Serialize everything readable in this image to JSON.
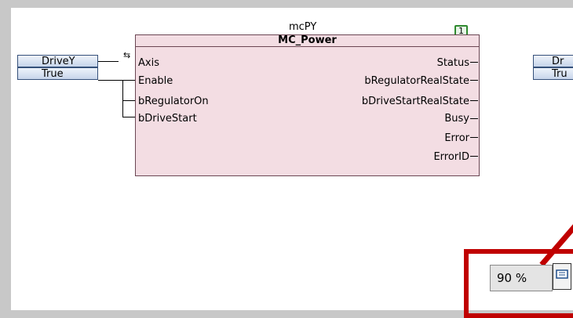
{
  "instance_name": "mcPY",
  "block_type": "MC_Power",
  "execution_order": "1",
  "inputs": {
    "axis_value": "DriveY",
    "enable_value": "True",
    "axis_label": "Axis",
    "enable_label": "Enable",
    "regulator_on_label": "bRegulatorOn",
    "drive_start_label": "bDriveStart",
    "axis_arrow_icon": "bidirectional-arrow"
  },
  "outputs": {
    "status": "Status",
    "regulator_real_state": "bRegulatorRealState",
    "drive_start_real_state": "bDriveStartRealState",
    "busy": "Busy",
    "error": "Error",
    "error_id": "ErrorID"
  },
  "right_partial": {
    "drive_value": "Dr",
    "true_value": "Tru"
  },
  "zoom": {
    "level": "90 %"
  },
  "colors": {
    "block_fill": "#f3dde3",
    "block_border": "#6b4653",
    "input_fill": "#dfe8f6",
    "highlight": "#c00000",
    "exec_badge": "#2f8a2f"
  }
}
